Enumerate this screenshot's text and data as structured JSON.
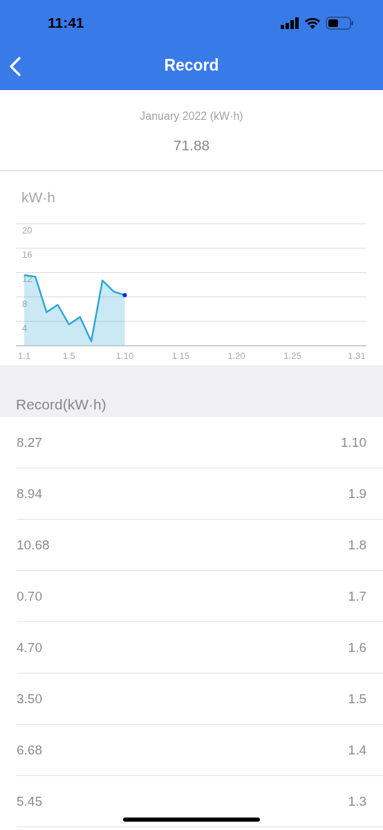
{
  "status_bar": {
    "time": "11:41"
  },
  "nav": {
    "title": "Record"
  },
  "summary": {
    "label": "January 2022 (kW·h)",
    "value": "71.88"
  },
  "chart": {
    "unit": "kW·h",
    "chart_data": {
      "type": "area",
      "categories": [
        "1.1",
        null,
        null,
        null,
        "1.5",
        null,
        null,
        null,
        null,
        "1.10",
        null,
        null,
        null,
        null,
        "1.15",
        null,
        null,
        null,
        null,
        "1.20",
        null,
        null,
        null,
        null,
        "1.25",
        null,
        null,
        null,
        null,
        null,
        "1.31"
      ],
      "series": [
        {
          "color": "#2ea7d8",
          "values": [
            11.6,
            11.3,
            5.5,
            6.7,
            3.5,
            4.7,
            0.7,
            10.7,
            8.9,
            8.3,
            null,
            null,
            null,
            null,
            null,
            null,
            null,
            null,
            null,
            null,
            null,
            null,
            null,
            null,
            null,
            null,
            null,
            null,
            null,
            null,
            null
          ]
        }
      ],
      "ylim": [
        0,
        20
      ],
      "yticks": [
        4,
        8,
        12,
        16,
        20
      ],
      "grid": true
    }
  },
  "records": {
    "title": "Record(kW·h)",
    "rows": [
      {
        "value": "8.27",
        "date": "1.10"
      },
      {
        "value": "8.94",
        "date": "1.9"
      },
      {
        "value": "10.68",
        "date": "1.8"
      },
      {
        "value": "0.70",
        "date": "1.7"
      },
      {
        "value": "4.70",
        "date": "1.6"
      },
      {
        "value": "3.50",
        "date": "1.5"
      },
      {
        "value": "6.68",
        "date": "1.4"
      },
      {
        "value": "5.45",
        "date": "1.3"
      }
    ]
  }
}
